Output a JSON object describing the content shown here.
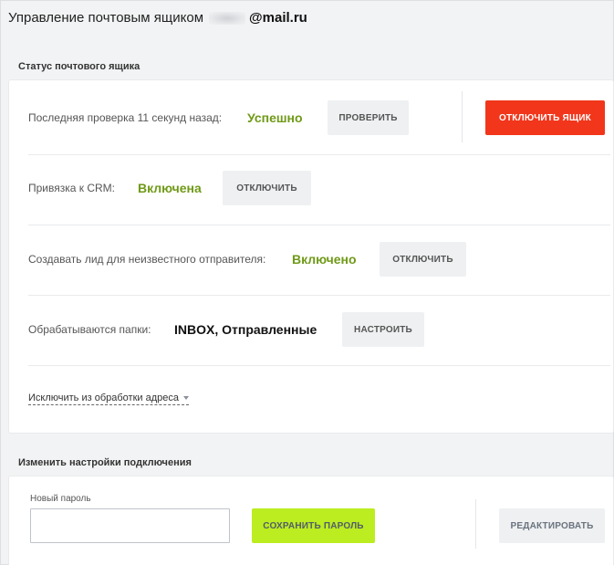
{
  "header": {
    "title": "Управление почтовым ящиком",
    "domain": "@mail.ru"
  },
  "status_section": {
    "title": "Статус почтового ящика",
    "last_check": {
      "label": "Последняя проверка 11 секунд назад:",
      "status": "Успешно",
      "button": "Проверить"
    },
    "disable_mailbox_button": "Отключить ящик",
    "crm": {
      "label": "Привязка к CRM:",
      "status": "Включена",
      "button": "Отключить"
    },
    "lead": {
      "label": "Создавать лид для неизвестного отправителя:",
      "status": "Включено",
      "button": "Отключить"
    },
    "folders": {
      "label": "Обрабатываются папки:",
      "value": "INBOX, Отправленные",
      "button": "Настроить"
    },
    "exclude_link": "Исключить из обработки адреса"
  },
  "connection_section": {
    "title": "Изменить настройки подключения",
    "password_label": "Новый пароль",
    "password_value": "",
    "save_button": "Сохранить пароль",
    "edit_button": "Редактировать"
  },
  "colors": {
    "status_green": "#6f9a17",
    "danger": "#f1361b",
    "save_green": "#bbed21"
  }
}
